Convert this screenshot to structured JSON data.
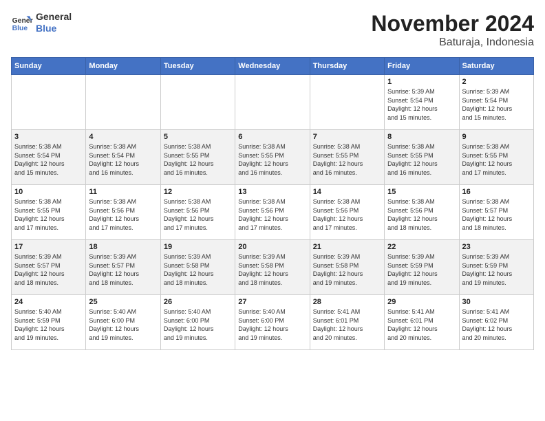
{
  "header": {
    "logo_line1": "General",
    "logo_line2": "Blue",
    "title": "November 2024",
    "subtitle": "Baturaja, Indonesia"
  },
  "weekdays": [
    "Sunday",
    "Monday",
    "Tuesday",
    "Wednesday",
    "Thursday",
    "Friday",
    "Saturday"
  ],
  "weeks": [
    [
      {
        "day": "",
        "info": ""
      },
      {
        "day": "",
        "info": ""
      },
      {
        "day": "",
        "info": ""
      },
      {
        "day": "",
        "info": ""
      },
      {
        "day": "",
        "info": ""
      },
      {
        "day": "1",
        "info": "Sunrise: 5:39 AM\nSunset: 5:54 PM\nDaylight: 12 hours\nand 15 minutes."
      },
      {
        "day": "2",
        "info": "Sunrise: 5:39 AM\nSunset: 5:54 PM\nDaylight: 12 hours\nand 15 minutes."
      }
    ],
    [
      {
        "day": "3",
        "info": "Sunrise: 5:38 AM\nSunset: 5:54 PM\nDaylight: 12 hours\nand 15 minutes."
      },
      {
        "day": "4",
        "info": "Sunrise: 5:38 AM\nSunset: 5:54 PM\nDaylight: 12 hours\nand 16 minutes."
      },
      {
        "day": "5",
        "info": "Sunrise: 5:38 AM\nSunset: 5:55 PM\nDaylight: 12 hours\nand 16 minutes."
      },
      {
        "day": "6",
        "info": "Sunrise: 5:38 AM\nSunset: 5:55 PM\nDaylight: 12 hours\nand 16 minutes."
      },
      {
        "day": "7",
        "info": "Sunrise: 5:38 AM\nSunset: 5:55 PM\nDaylight: 12 hours\nand 16 minutes."
      },
      {
        "day": "8",
        "info": "Sunrise: 5:38 AM\nSunset: 5:55 PM\nDaylight: 12 hours\nand 16 minutes."
      },
      {
        "day": "9",
        "info": "Sunrise: 5:38 AM\nSunset: 5:55 PM\nDaylight: 12 hours\nand 17 minutes."
      }
    ],
    [
      {
        "day": "10",
        "info": "Sunrise: 5:38 AM\nSunset: 5:55 PM\nDaylight: 12 hours\nand 17 minutes."
      },
      {
        "day": "11",
        "info": "Sunrise: 5:38 AM\nSunset: 5:56 PM\nDaylight: 12 hours\nand 17 minutes."
      },
      {
        "day": "12",
        "info": "Sunrise: 5:38 AM\nSunset: 5:56 PM\nDaylight: 12 hours\nand 17 minutes."
      },
      {
        "day": "13",
        "info": "Sunrise: 5:38 AM\nSunset: 5:56 PM\nDaylight: 12 hours\nand 17 minutes."
      },
      {
        "day": "14",
        "info": "Sunrise: 5:38 AM\nSunset: 5:56 PM\nDaylight: 12 hours\nand 17 minutes."
      },
      {
        "day": "15",
        "info": "Sunrise: 5:38 AM\nSunset: 5:56 PM\nDaylight: 12 hours\nand 18 minutes."
      },
      {
        "day": "16",
        "info": "Sunrise: 5:38 AM\nSunset: 5:57 PM\nDaylight: 12 hours\nand 18 minutes."
      }
    ],
    [
      {
        "day": "17",
        "info": "Sunrise: 5:39 AM\nSunset: 5:57 PM\nDaylight: 12 hours\nand 18 minutes."
      },
      {
        "day": "18",
        "info": "Sunrise: 5:39 AM\nSunset: 5:57 PM\nDaylight: 12 hours\nand 18 minutes."
      },
      {
        "day": "19",
        "info": "Sunrise: 5:39 AM\nSunset: 5:58 PM\nDaylight: 12 hours\nand 18 minutes."
      },
      {
        "day": "20",
        "info": "Sunrise: 5:39 AM\nSunset: 5:58 PM\nDaylight: 12 hours\nand 18 minutes."
      },
      {
        "day": "21",
        "info": "Sunrise: 5:39 AM\nSunset: 5:58 PM\nDaylight: 12 hours\nand 19 minutes."
      },
      {
        "day": "22",
        "info": "Sunrise: 5:39 AM\nSunset: 5:59 PM\nDaylight: 12 hours\nand 19 minutes."
      },
      {
        "day": "23",
        "info": "Sunrise: 5:39 AM\nSunset: 5:59 PM\nDaylight: 12 hours\nand 19 minutes."
      }
    ],
    [
      {
        "day": "24",
        "info": "Sunrise: 5:40 AM\nSunset: 5:59 PM\nDaylight: 12 hours\nand 19 minutes."
      },
      {
        "day": "25",
        "info": "Sunrise: 5:40 AM\nSunset: 6:00 PM\nDaylight: 12 hours\nand 19 minutes."
      },
      {
        "day": "26",
        "info": "Sunrise: 5:40 AM\nSunset: 6:00 PM\nDaylight: 12 hours\nand 19 minutes."
      },
      {
        "day": "27",
        "info": "Sunrise: 5:40 AM\nSunset: 6:00 PM\nDaylight: 12 hours\nand 19 minutes."
      },
      {
        "day": "28",
        "info": "Sunrise: 5:41 AM\nSunset: 6:01 PM\nDaylight: 12 hours\nand 20 minutes."
      },
      {
        "day": "29",
        "info": "Sunrise: 5:41 AM\nSunset: 6:01 PM\nDaylight: 12 hours\nand 20 minutes."
      },
      {
        "day": "30",
        "info": "Sunrise: 5:41 AM\nSunset: 6:02 PM\nDaylight: 12 hours\nand 20 minutes."
      }
    ]
  ]
}
